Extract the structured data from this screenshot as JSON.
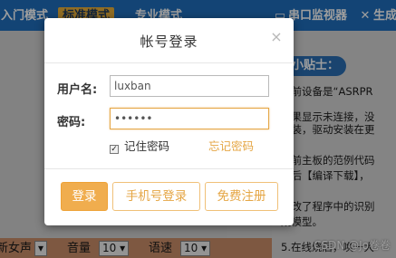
{
  "background": {
    "modes": [
      {
        "label": "入门模式",
        "active": false
      },
      {
        "label": "标准模式",
        "active": true
      },
      {
        "label": "专业模式",
        "active": false
      }
    ],
    "tools": [
      {
        "label": "串口监视器",
        "icon": "monitor-icon"
      },
      {
        "label": "生成",
        "icon": "tools-icon"
      }
    ],
    "tips": {
      "title": "小贴士：",
      "lines": [
        "当前设备是“ASRPR",
        "如果显示未连接，没",
        "安装，驱动安装在更",
        "当前主板的范例代码",
        "定后【编译下载】，",
        "修改了程序中的识别",
        "成模型。",
        "5.在线烧后，唤一大"
      ]
    },
    "bottom": {
      "voice_label": "新女声",
      "volume_label": "音量",
      "volume_value": "10",
      "speed_label": "语速",
      "speed_value": "10"
    },
    "watermark": "CSDN @Jo卷卷"
  },
  "modal": {
    "title": "帐号登录",
    "close_symbol": "×",
    "username_label": "用户名:",
    "username_value": "luxban",
    "password_label": "密码:",
    "password_value": "••••••",
    "remember_label": "记住密码",
    "remember_checked": true,
    "forgot_label": "忘记密码",
    "buttons": {
      "login": "登录",
      "phone_login": "手机号登录",
      "register": "免费注册"
    }
  },
  "colors": {
    "accent": "#f0ad4e",
    "topbar": "#1f6fbd",
    "tips_badge": "#2b6fb3"
  }
}
